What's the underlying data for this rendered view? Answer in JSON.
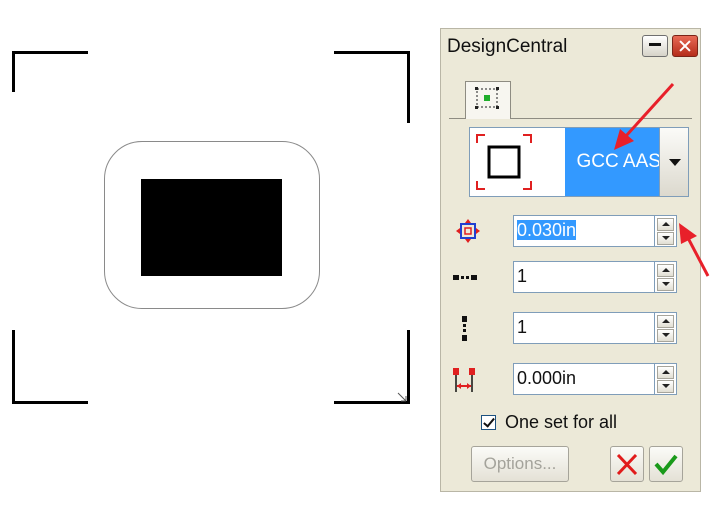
{
  "window": {
    "title": "DesignCentral",
    "minimize_icon": "minimize-icon",
    "close_icon": "close-icon"
  },
  "tabs": [
    {
      "icon": "object-selection-icon",
      "selected": true
    }
  ],
  "style_selector": {
    "selected_value": "GCC AASII",
    "preview_icon": "square-outline-icon",
    "dropdown_icon": "chevron-down-icon"
  },
  "fields": [
    {
      "icon": "offset-icon",
      "value": "0.030in",
      "selected_text": true
    },
    {
      "icon": "horizontal-dots-icon",
      "value": "1"
    },
    {
      "icon": "vertical-dots-icon",
      "value": "1"
    },
    {
      "icon": "spacing-icon",
      "value": "0.000in"
    }
  ],
  "checkbox": {
    "label": "One set for all",
    "checked": true
  },
  "buttons": {
    "options_label": "Options...",
    "options_enabled": false,
    "cancel_icon": "red-x-icon",
    "ok_icon": "green-check-icon"
  },
  "colors": {
    "selection": "#3399ff",
    "panel_bg": "#ece9d8",
    "annotation_arrow": "#e8202a",
    "cancel": "#e11b1b",
    "ok": "#1a9a1a"
  }
}
